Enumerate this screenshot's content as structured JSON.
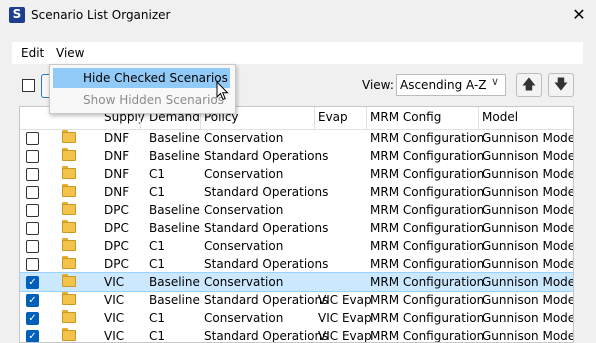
{
  "window": {
    "title": "Scenario List Organizer",
    "icon": "app-s-icon",
    "close_glyph": "✕"
  },
  "menu": {
    "edit": "Edit",
    "view": "View",
    "dropdown": {
      "hide_checked": "Hide Checked Scenarios",
      "show_hidden": "Show Hidden Scenarios"
    }
  },
  "toolbar": {
    "view_label": "View:",
    "view_value": "Ascending A-Z",
    "up_glyph": "🡅",
    "down_glyph": "🡇"
  },
  "table": {
    "columns": {
      "supply": "Supply",
      "demand": "Demand",
      "policy": "Policy",
      "evap": "Evap",
      "mrm": "MRM Config",
      "model": "Model"
    },
    "rows": [
      {
        "checked": false,
        "selected": false,
        "supply": "DNF",
        "demand": "Baseline",
        "policy": "Conservation",
        "evap": "",
        "mrm": "MRM Configuration",
        "model": "Gunnison Model"
      },
      {
        "checked": false,
        "selected": false,
        "supply": "DNF",
        "demand": "Baseline",
        "policy": "Standard Operations",
        "evap": "",
        "mrm": "MRM Configuration",
        "model": "Gunnison Model"
      },
      {
        "checked": false,
        "selected": false,
        "supply": "DNF",
        "demand": "C1",
        "policy": "Conservation",
        "evap": "",
        "mrm": "MRM Configuration",
        "model": "Gunnison Model"
      },
      {
        "checked": false,
        "selected": false,
        "supply": "DNF",
        "demand": "C1",
        "policy": "Standard Operations",
        "evap": "",
        "mrm": "MRM Configuration",
        "model": "Gunnison Model"
      },
      {
        "checked": false,
        "selected": false,
        "supply": "DPC",
        "demand": "Baseline",
        "policy": "Conservation",
        "evap": "",
        "mrm": "MRM Configuration",
        "model": "Gunnison Model"
      },
      {
        "checked": false,
        "selected": false,
        "supply": "DPC",
        "demand": "Baseline",
        "policy": "Standard Operations",
        "evap": "",
        "mrm": "MRM Configuration",
        "model": "Gunnison Model"
      },
      {
        "checked": false,
        "selected": false,
        "supply": "DPC",
        "demand": "C1",
        "policy": "Conservation",
        "evap": "",
        "mrm": "MRM Configuration",
        "model": "Gunnison Model"
      },
      {
        "checked": false,
        "selected": false,
        "supply": "DPC",
        "demand": "C1",
        "policy": "Standard Operations",
        "evap": "",
        "mrm": "MRM Configuration",
        "model": "Gunnison Model"
      },
      {
        "checked": true,
        "selected": true,
        "supply": "VIC",
        "demand": "Baseline",
        "policy": "Conservation",
        "evap": "",
        "mrm": "MRM Configuration",
        "model": "Gunnison Model"
      },
      {
        "checked": true,
        "selected": false,
        "supply": "VIC",
        "demand": "Baseline",
        "policy": "Standard Operations",
        "evap": "VIC Evap",
        "mrm": "MRM Configuration",
        "model": "Gunnison Model"
      },
      {
        "checked": true,
        "selected": false,
        "supply": "VIC",
        "demand": "C1",
        "policy": "Conservation",
        "evap": "VIC Evap",
        "mrm": "MRM Configuration",
        "model": "Gunnison Model"
      },
      {
        "checked": true,
        "selected": false,
        "supply": "VIC",
        "demand": "C1",
        "policy": "Standard Operations",
        "evap": "VIC Evap",
        "mrm": "MRM Configuration",
        "model": "Gunnison Model"
      }
    ]
  },
  "colors": {
    "accent": "#005fb8",
    "selection": "#cce8ff",
    "menu_hover": "#91c9f7",
    "folder": "#f3c24a"
  }
}
